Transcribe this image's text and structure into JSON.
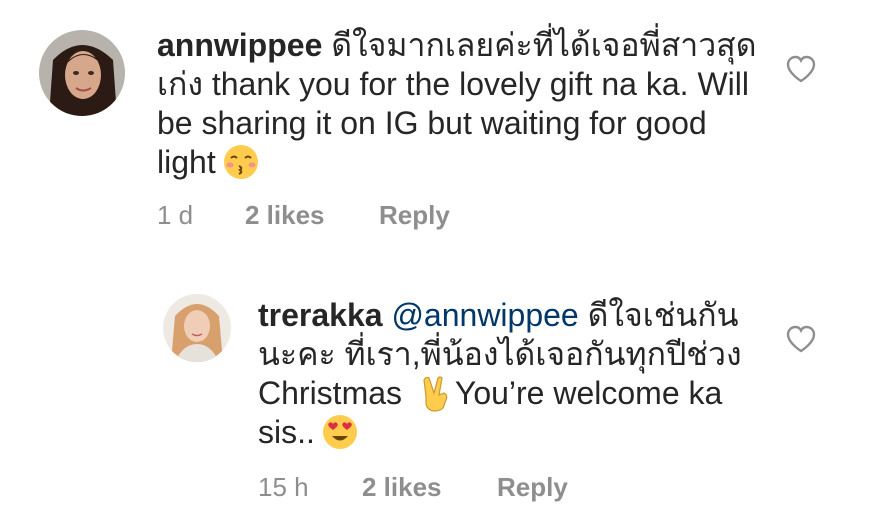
{
  "comments": [
    {
      "username": "annwippee",
      "text": " ดีใจมากเลยค่ะที่ได้เจอพี่สาวสุดเก่ง thank you for the lovely gift na ka. Will be sharing it on IG but waiting for good light",
      "emoji": "kissing-face-emoji",
      "time": "1 d",
      "likes": "2 likes",
      "reply_label": "Reply"
    },
    {
      "username": "trerakka",
      "mention": "@annwippee",
      "text": " ดีใจเช่นกันนะคะ ที่เรา,พี่น้องได้เจอกันทุกปีช่วง Christmas",
      "emoji_1": "victory-hand-emoji",
      "text_2": "You’re welcome ka sis..",
      "emoji_2": "heart-eyes-emoji",
      "time": "15 h",
      "likes": "2 likes",
      "reply_label": "Reply"
    }
  ],
  "icons": {
    "like": "heart-outline-icon"
  },
  "colors": {
    "text": "#262626",
    "meta": "#8e8e8e",
    "mention": "#00376b"
  }
}
